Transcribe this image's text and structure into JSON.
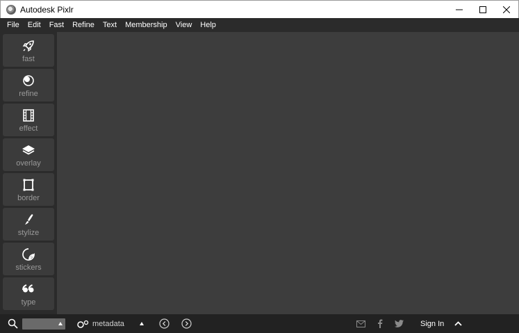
{
  "window": {
    "title": "Autodesk Pixlr",
    "controls": [
      "minimize-icon",
      "maximize-icon",
      "close-icon"
    ]
  },
  "menu": {
    "items": [
      "File",
      "Edit",
      "Fast",
      "Refine",
      "Text",
      "Membership",
      "View",
      "Help"
    ]
  },
  "sidebar": {
    "tools": [
      {
        "label": "fast",
        "icon": "rocket-icon"
      },
      {
        "label": "refine",
        "icon": "refine-icon"
      },
      {
        "label": "effect",
        "icon": "film-icon"
      },
      {
        "label": "overlay",
        "icon": "layers-icon"
      },
      {
        "label": "border",
        "icon": "frame-icon"
      },
      {
        "label": "stylize",
        "icon": "brush-icon"
      },
      {
        "label": "stickers",
        "icon": "sticker-icon"
      },
      {
        "label": "type",
        "icon": "quote-icon"
      }
    ]
  },
  "bottom": {
    "search_value": "",
    "metadata_label": "metadata",
    "signin_label": "Sign In"
  },
  "colors": {
    "menubar": "#2b2b2b",
    "workspace": "#3d3d3d",
    "tool_bg": "#3b3b3b",
    "tool_label": "#9a9a9a",
    "bottombar": "#222222"
  }
}
